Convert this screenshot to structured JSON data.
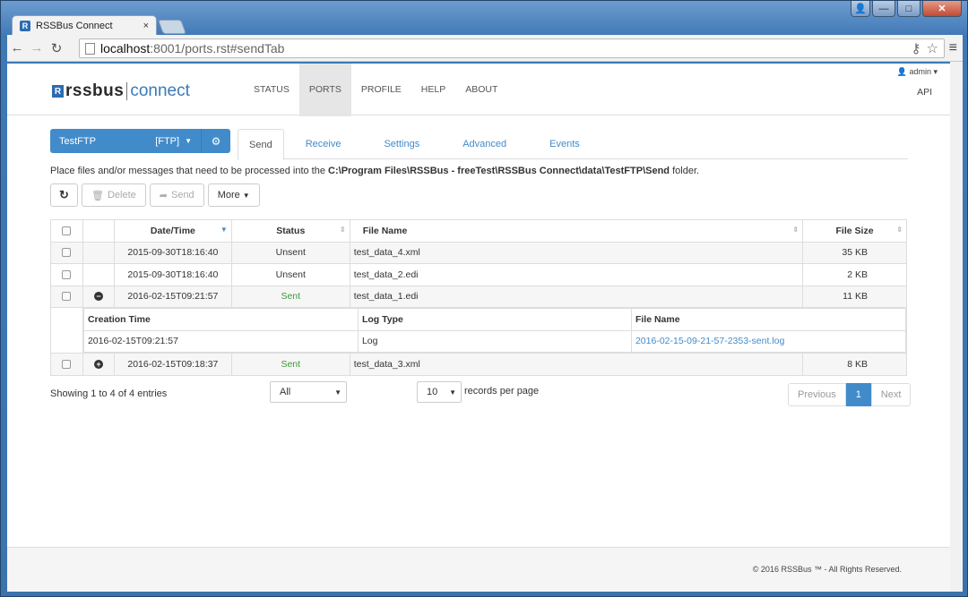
{
  "browser": {
    "tab_title": "RSSBus Connect",
    "tab_close": "×",
    "url_host": "localhost",
    "url_path": ":8001/ports.rst#sendTab",
    "win_controls": {
      "user": "👤",
      "min": "—",
      "max": "□",
      "close": "✕"
    }
  },
  "header": {
    "logo_rss": "rssbus",
    "logo_connect": "connect",
    "nav": [
      "STATUS",
      "PORTS",
      "PROFILE",
      "HELP",
      "ABOUT"
    ],
    "active_nav": "PORTS",
    "admin": "admin",
    "api": "API"
  },
  "port": {
    "name": "TestFTP",
    "type": "[FTP]"
  },
  "subtabs": [
    "Send",
    "Receive",
    "Settings",
    "Advanced",
    "Events"
  ],
  "info": {
    "prefix": "Place files and/or messages that need to be processed into the ",
    "path": "C:\\Program Files\\RSSBus - freeTest\\RSSBus Connect\\data\\TestFTP\\Send",
    "suffix": " folder."
  },
  "actions": {
    "delete": "Delete",
    "send": "Send",
    "more": "More"
  },
  "table": {
    "headers": [
      "Date/Time",
      "Status",
      "File Name",
      "File Size"
    ],
    "rows": [
      {
        "datetime": "2015-09-30T18:16:40",
        "status": "Unsent",
        "file": "test_data_4.xml",
        "size": "35 KB"
      },
      {
        "datetime": "2015-09-30T18:16:40",
        "status": "Unsent",
        "file": "test_data_2.edi",
        "size": "2 KB"
      },
      {
        "datetime": "2016-02-15T09:21:57",
        "status": "Sent",
        "file": "test_data_1.edi",
        "size": "11 KB"
      },
      {
        "datetime": "2016-02-15T09:18:37",
        "status": "Sent",
        "file": "test_data_3.xml",
        "size": "8 KB"
      }
    ],
    "detail": {
      "headers": [
        "Creation Time",
        "Log Type",
        "File Name"
      ],
      "row": {
        "created": "2016-02-15T09:21:57",
        "type": "Log",
        "file": "2016-02-15-09-21-57-2353-sent.log"
      }
    }
  },
  "footer_controls": {
    "showing": "Showing 1 to 4 of 4 entries",
    "filter_value": "All",
    "rpp_value": "10",
    "rpp_label": "records per page",
    "prev": "Previous",
    "page": "1",
    "next": "Next"
  },
  "copyright": "© 2016 RSSBus ™ - All Rights Reserved."
}
